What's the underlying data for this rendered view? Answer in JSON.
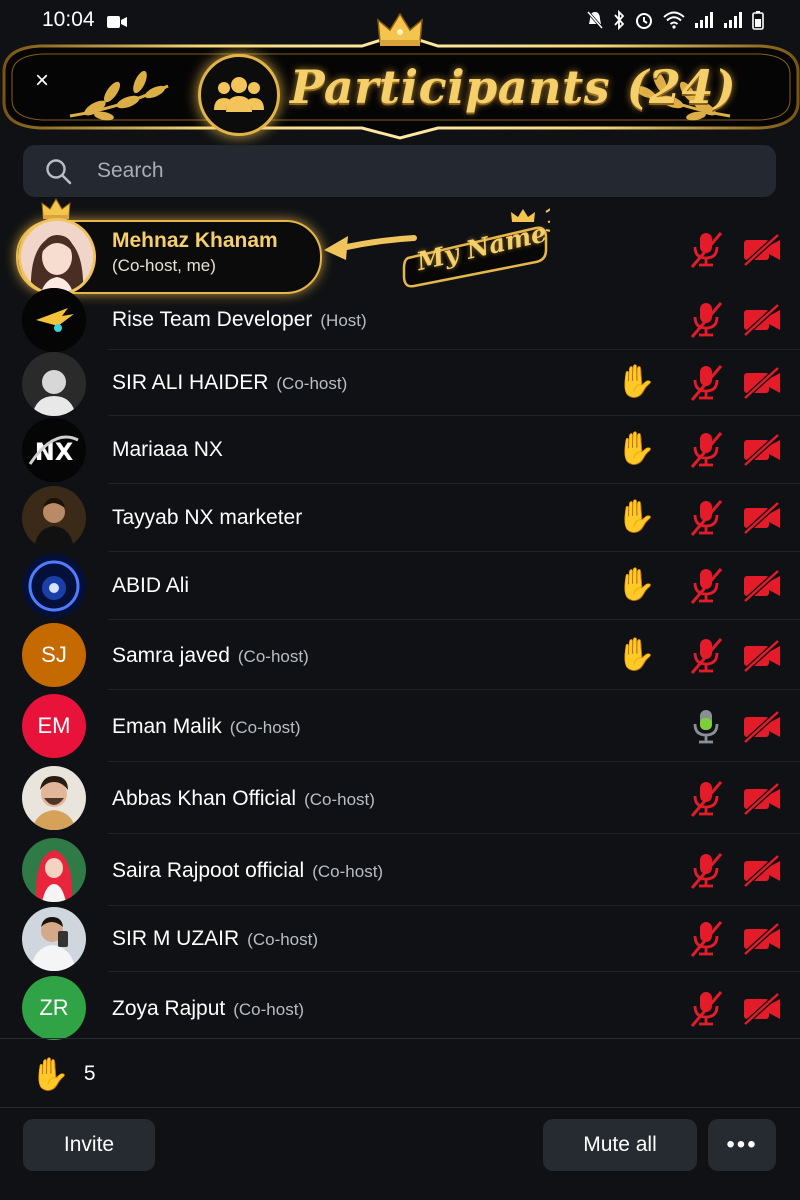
{
  "status_bar": {
    "time": "10:04"
  },
  "header": {
    "title": "Participants (24)",
    "close_icon": "×"
  },
  "search": {
    "placeholder": "Search"
  },
  "me": {
    "name": "Mehnaz Khanam",
    "role": "(Co-host, me)",
    "tag": "My Name"
  },
  "participants": [
    {
      "name": "Rise Team Developer",
      "role": "(Host)",
      "hand": false,
      "mic": "muted",
      "camera": "off"
    },
    {
      "name": "SIR ALI HAIDER",
      "role": "(Co-host)",
      "hand": true,
      "mic": "muted",
      "camera": "off"
    },
    {
      "name": "Mariaaa NX",
      "role": "",
      "hand": true,
      "mic": "muted",
      "camera": "off"
    },
    {
      "name": "Tayyab NX marketer",
      "role": "",
      "hand": true,
      "mic": "muted",
      "camera": "off"
    },
    {
      "name": "ABID Ali",
      "role": "",
      "hand": true,
      "mic": "muted",
      "camera": "off"
    },
    {
      "name": "Samra javed",
      "role": "(Co-host)",
      "hand": true,
      "mic": "muted",
      "camera": "off",
      "initials": "SJ",
      "color": "#c46a00"
    },
    {
      "name": "Eman Malik",
      "role": "(Co-host)",
      "hand": false,
      "mic": "active",
      "camera": "off",
      "initials": "EM",
      "color": "#e8123a"
    },
    {
      "name": "Abbas Khan Official",
      "role": "(Co-host)",
      "hand": false,
      "mic": "muted",
      "camera": "off"
    },
    {
      "name": "Saira Rajpoot official",
      "role": "(Co-host)",
      "hand": false,
      "mic": "muted",
      "camera": "off"
    },
    {
      "name": "SIR M UZAIR",
      "role": "(Co-host)",
      "hand": false,
      "mic": "muted",
      "camera": "off"
    },
    {
      "name": "Zoya Rajput",
      "role": "(Co-host)",
      "hand": false,
      "mic": "muted",
      "camera": "off",
      "initials": "ZR",
      "color": "#2fa345"
    }
  ],
  "footer": {
    "raised_hands_count": "5",
    "invite_label": "Invite",
    "mute_all_label": "Mute all",
    "more_label": "•••"
  },
  "colors": {
    "gold": "#f5cf6a",
    "muted_red": "#e41c2a",
    "active_green": "#7ccf3a",
    "background": "#0f1114"
  }
}
